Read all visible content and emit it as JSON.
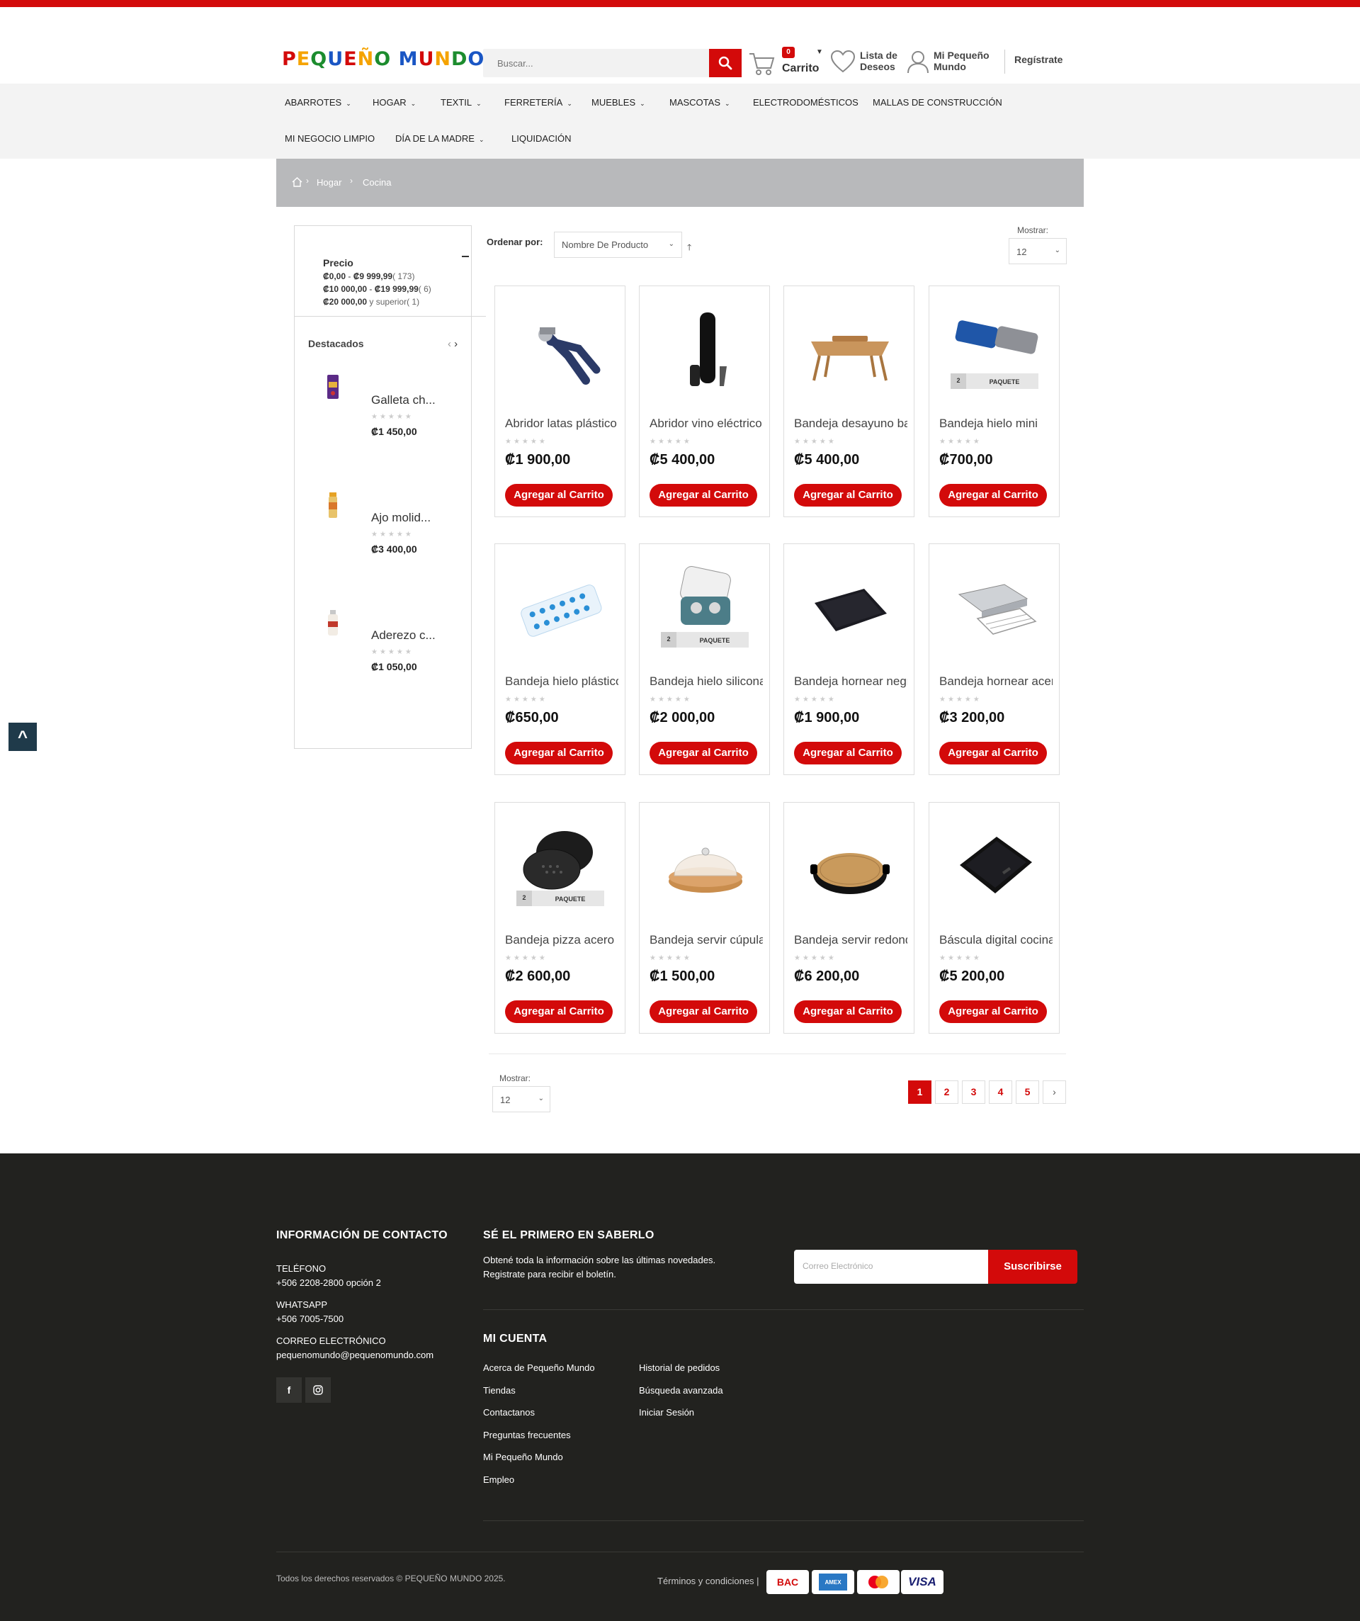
{
  "header": {
    "logo_text": "PEQUEÑO MUNDO",
    "search_placeholder": "Buscar...",
    "cart_count": "0",
    "cart_label": "Carrito",
    "wishlist_line1": "Lista de",
    "wishlist_line2": "Deseos",
    "account_line1": "Mi Pequeño",
    "account_line2": "Mundo",
    "register": "Regístrate"
  },
  "nav": [
    {
      "label": "ABARROTES",
      "dropdown": true
    },
    {
      "label": "HOGAR",
      "dropdown": true
    },
    {
      "label": "TEXTIL",
      "dropdown": true
    },
    {
      "label": "FERRETERÍA",
      "dropdown": true
    },
    {
      "label": "MUEBLES",
      "dropdown": true
    },
    {
      "label": "MASCOTAS",
      "dropdown": true
    },
    {
      "label": "ELECTRODOMÉSTICOS",
      "dropdown": false
    },
    {
      "label": "MALLAS DE CONSTRUCCIÓN",
      "dropdown": false
    },
    {
      "label": "MI NEGOCIO LIMPIO",
      "dropdown": false
    },
    {
      "label": "DÍA DE LA MADRE",
      "dropdown": true
    },
    {
      "label": "LIQUIDACIÓN",
      "dropdown": false
    }
  ],
  "breadcrumb": [
    "Hogar",
    "Cocina"
  ],
  "filter": {
    "title": "Precio",
    "options": [
      {
        "range_from": "₡0,00",
        "range_to": "₡9 999,99",
        "count": "( 173)"
      },
      {
        "range_from": "₡10 000,00",
        "range_to": "₡19 999,99",
        "count": "( 6)"
      },
      {
        "range_from": "₡20 000,00",
        "range_to": "y superior",
        "count": "( 1)"
      }
    ]
  },
  "featured": {
    "title": "Destacados",
    "items": [
      {
        "name": "Galleta ch...",
        "price": "₡1 450,00"
      },
      {
        "name": "Ajo molid...",
        "price": "₡3 400,00"
      },
      {
        "name": "Aderezo c...",
        "price": "₡1 050,00"
      }
    ]
  },
  "toolbar": {
    "sort_label": "Ordenar por:",
    "sort_value": "Nombre De Producto",
    "show_label": "Mostrar:",
    "show_value": "12"
  },
  "products": [
    {
      "name": "Abridor latas plástico",
      "price": "₡1 900,00",
      "icon": "can-opener-image"
    },
    {
      "name": "Abridor vino eléctrico",
      "price": "₡5 400,00",
      "icon": "wine-opener-image"
    },
    {
      "name": "Bandeja desayuno bambú",
      "price": "₡5 400,00",
      "icon": "breakfast-tray-image"
    },
    {
      "name": "Bandeja hielo mini",
      "price": "₡700,00",
      "icon": "ice-tray-mini-image",
      "badge": "PAQUETE",
      "badge_qty": "2"
    },
    {
      "name": "Bandeja hielo plástico",
      "price": "₡650,00",
      "icon": "ice-tray-plastic-image"
    },
    {
      "name": "Bandeja hielo silicona",
      "price": "₡2 000,00",
      "icon": "ice-tray-silicone-image",
      "badge": "PAQUETE",
      "badge_qty": "2"
    },
    {
      "name": "Bandeja hornear negra",
      "price": "₡1 900,00",
      "icon": "baking-tray-black-image"
    },
    {
      "name": "Bandeja hornear acero",
      "price": "₡3 200,00",
      "icon": "baking-tray-steel-image"
    },
    {
      "name": "Bandeja pizza acero",
      "price": "₡2 600,00",
      "icon": "pizza-tray-image",
      "badge": "PAQUETE",
      "badge_qty": "2"
    },
    {
      "name": "Bandeja servir cúpula",
      "price": "₡1 500,00",
      "icon": "serving-dome-image"
    },
    {
      "name": "Bandeja servir redonda",
      "price": "₡6 200,00",
      "icon": "round-serving-tray-image"
    },
    {
      "name": "Báscula digital cocina",
      "price": "₡5 200,00",
      "icon": "digital-scale-image"
    }
  ],
  "add_to_cart": "Agregar al Carrito",
  "pagination": [
    "1",
    "2",
    "3",
    "4",
    "5"
  ],
  "footer": {
    "contact_title": "INFORMACIÓN DE CONTACTO",
    "phone_label": "TELÉFONO",
    "phone": "+506 2208-2800 opción 2",
    "whatsapp_label": "WHATSAPP",
    "whatsapp": "+506 7005-7500",
    "email_label": "CORREO ELECTRÓNICO",
    "email": "pequenomundo@pequenomundo.com",
    "newsletter_title": "SÉ EL PRIMERO EN SABERLO",
    "newsletter_line1": "Obtené toda la información sobre las últimas novedades.",
    "newsletter_line2": "Registrate para recibir el boletín.",
    "newsletter_placeholder": "Correo Electrónico",
    "newsletter_button": "Suscribirse",
    "account_title": "MI CUENTA",
    "links_col1": [
      "Acerca de Pequeño Mundo",
      "Tiendas",
      "Contactanos",
      "Preguntas frecuentes",
      "Mi Pequeño Mundo",
      "Empleo"
    ],
    "links_col2": [
      "Historial de pedidos",
      "Búsqueda avanzada",
      "Iniciar Sesión"
    ],
    "copyright": "Todos los derechos reservados © PEQUEÑO MUNDO 2025.",
    "terms": "Términos y condiciones |",
    "payments": [
      "BAC",
      "AMEX",
      "Mastercard",
      "VISA"
    ]
  }
}
